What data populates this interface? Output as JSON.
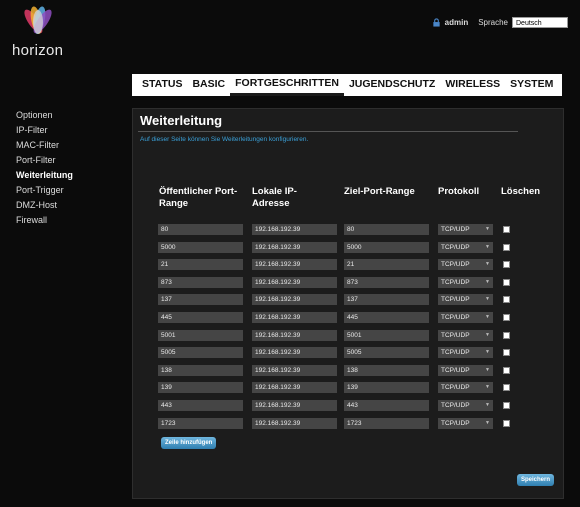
{
  "brand": {
    "name": "horizon"
  },
  "topbar": {
    "user": "admin",
    "language_label": "Sprache",
    "language": "Deutsch"
  },
  "tabs": [
    {
      "label": "STATUS"
    },
    {
      "label": "BASIC"
    },
    {
      "label": "FORTGESCHRITTEN"
    },
    {
      "label": "JUGENDSCHUTZ"
    },
    {
      "label": "WIRELESS"
    },
    {
      "label": "SYSTEM"
    }
  ],
  "sidebar": {
    "items": [
      {
        "label": "Optionen"
      },
      {
        "label": "IP-Filter"
      },
      {
        "label": "MAC-Filter"
      },
      {
        "label": "Port-Filter"
      },
      {
        "label": "Weiterleitung"
      },
      {
        "label": "Port-Trigger"
      },
      {
        "label": "DMZ-Host"
      },
      {
        "label": "Firewall"
      }
    ]
  },
  "panel": {
    "title": "Weiterleitung",
    "description": "Auf dieser Seite können Sie Weiterleitungen konfigurieren."
  },
  "table": {
    "headers": {
      "public_port": "Öffentlicher Port-Range",
      "local_ip": "Lokale IP-Adresse",
      "target_port": "Ziel-Port-Range",
      "protocol": "Protokoll",
      "delete": "Löschen"
    },
    "rows": [
      {
        "public": "80",
        "ip": "192.168.192.39",
        "target": "80",
        "protocol": "TCP/UDP"
      },
      {
        "public": "5000",
        "ip": "192.168.192.39",
        "target": "5000",
        "protocol": "TCP/UDP"
      },
      {
        "public": "21",
        "ip": "192.168.192.39",
        "target": "21",
        "protocol": "TCP/UDP"
      },
      {
        "public": "873",
        "ip": "192.168.192.39",
        "target": "873",
        "protocol": "TCP/UDP"
      },
      {
        "public": "137",
        "ip": "192.168.192.39",
        "target": "137",
        "protocol": "TCP/UDP"
      },
      {
        "public": "445",
        "ip": "192.168.192.39",
        "target": "445",
        "protocol": "TCP/UDP"
      },
      {
        "public": "5001",
        "ip": "192.168.192.39",
        "target": "5001",
        "protocol": "TCP/UDP"
      },
      {
        "public": "5005",
        "ip": "192.168.192.39",
        "target": "5005",
        "protocol": "TCP/UDP"
      },
      {
        "public": "138",
        "ip": "192.168.192.39",
        "target": "138",
        "protocol": "TCP/UDP"
      },
      {
        "public": "139",
        "ip": "192.168.192.39",
        "target": "139",
        "protocol": "TCP/UDP"
      },
      {
        "public": "443",
        "ip": "192.168.192.39",
        "target": "443",
        "protocol": "TCP/UDP"
      },
      {
        "public": "1723",
        "ip": "192.168.192.39",
        "target": "1723",
        "protocol": "TCP/UDP"
      }
    ]
  },
  "buttons": {
    "add_row": "Zeile hinzufügen",
    "save": "Speichern"
  },
  "colors": {
    "accent": "#3aa0d8",
    "button": "#3b8ec0"
  }
}
